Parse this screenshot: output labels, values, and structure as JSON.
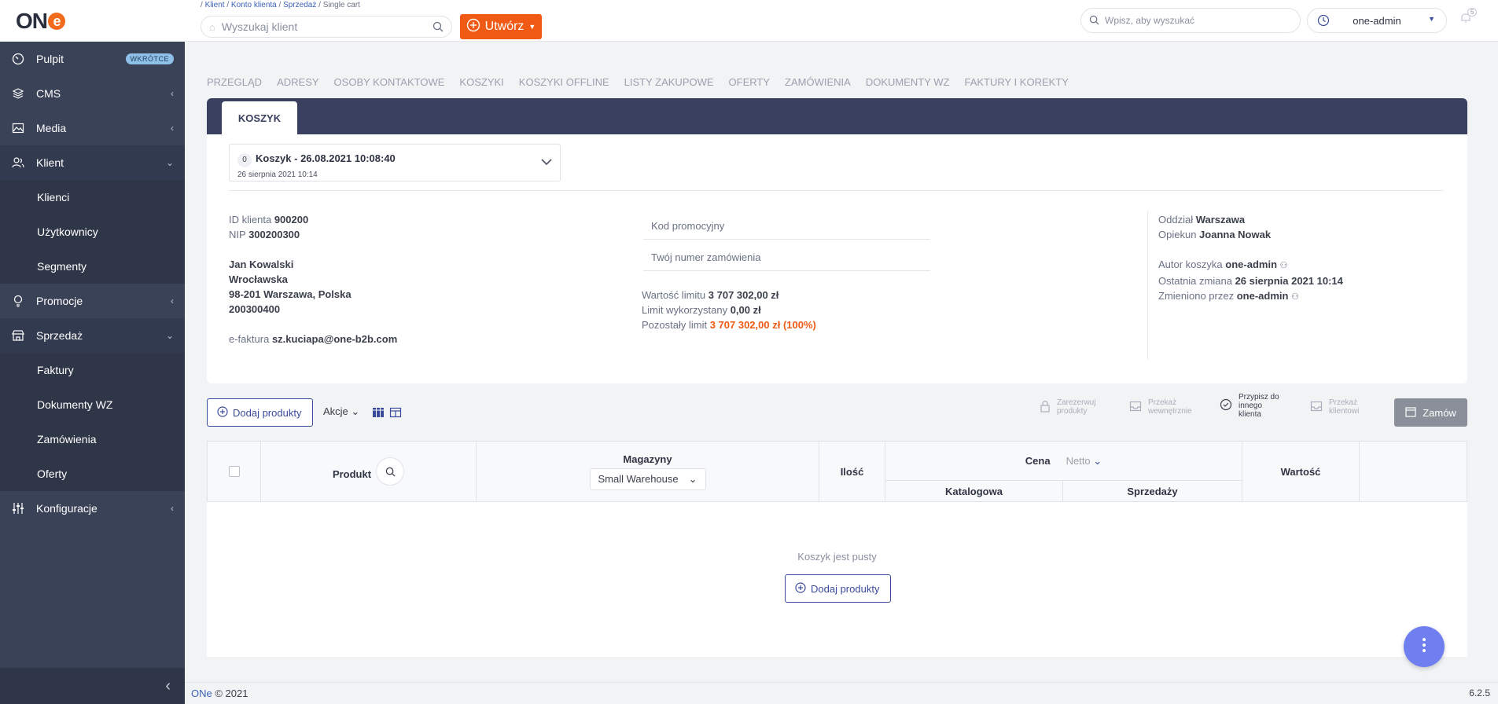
{
  "brand": {
    "name_prefix": "ON",
    "name_e": "e"
  },
  "sidebar": {
    "items": [
      {
        "label": "Pulpit",
        "icon": "dashboard-icon",
        "badge": "WKRÓTCE"
      },
      {
        "label": "CMS",
        "icon": "layers-icon"
      },
      {
        "label": "Media",
        "icon": "image-icon"
      },
      {
        "label": "Klient",
        "icon": "users-icon"
      },
      {
        "label": "Klienci"
      },
      {
        "label": "Użytkownicy"
      },
      {
        "label": "Segmenty"
      },
      {
        "label": "Promocje",
        "icon": "bulb-icon"
      },
      {
        "label": "Sprzedaż",
        "icon": "store-icon"
      },
      {
        "label": "Faktury"
      },
      {
        "label": "Dokumenty WZ"
      },
      {
        "label": "Zamówienia"
      },
      {
        "label": "Oferty"
      },
      {
        "label": "Konfiguracje",
        "icon": "sliders-icon"
      }
    ],
    "collapse": "‹"
  },
  "breadcrumb": [
    "Klient",
    "Konto klienta",
    "Sprzedaż",
    "Single cart"
  ],
  "topbar": {
    "client_search_placeholder": "Wyszukaj klient",
    "create_label": "Utwórz",
    "global_search_placeholder": "Wpisz, aby wyszukać",
    "user": "one-admin",
    "notif_count": "5"
  },
  "tabs": [
    "PRZEGLĄD",
    "ADRESY",
    "OSOBY KONTAKTOWE",
    "KOSZYKI",
    "KOSZYKI OFFLINE",
    "LISTY ZAKUPOWE",
    "OFERTY",
    "ZAMÓWIENIA",
    "DOKUMENTY WZ",
    "FAKTURY I KOREKTY"
  ],
  "card_tab": "KOSZYK",
  "cart": {
    "count": "0",
    "title": "Koszyk - 26.08.2021 10:08:40",
    "date": "26 sierpnia 2021 10:14"
  },
  "client": {
    "id_label": "ID klienta",
    "id": "900200",
    "nip_label": "NIP",
    "nip": "300200300",
    "name": "Jan Kowalski",
    "street": "Wrocławska",
    "city": "98-201 Warszawa, Polska",
    "phone": "200300400",
    "efaktura_label": "e-faktura",
    "email": "sz.kuciapa@one-b2b.com"
  },
  "fields": {
    "promo": "Kod promocyjny",
    "order_no": "Twój numer zamówienia"
  },
  "limits": {
    "value_label": "Wartość limitu",
    "value": "3 707 302,00 zł",
    "used_label": "Limit wykorzystany",
    "used": "0,00 zł",
    "left_label": "Pozostały limit",
    "left": "3 707 302,00 zł (100%)"
  },
  "meta": {
    "branch_label": "Oddział",
    "branch": "Warszawa",
    "keeper_label": "Opiekun",
    "keeper": "Joanna Nowak",
    "author_label": "Autor koszyka",
    "author": "one-admin",
    "changed_label": "Ostatnia zmiana",
    "changed": "26 sierpnia 2021 10:14",
    "changed_by_label": "Zmieniono przez",
    "changed_by": "one-admin"
  },
  "toolbar": {
    "add_products": "Dodaj produkty",
    "actions": "Akcje",
    "reserve": [
      "Zarezerwuj",
      "produkty"
    ],
    "transfer_internal": [
      "Przekaż",
      "wewnętrznie"
    ],
    "assign": [
      "Przypisz do",
      "innego",
      "klienta"
    ],
    "transfer_client": [
      "Przekaż",
      "klientowi"
    ],
    "order": "Zamów"
  },
  "table": {
    "product": "Produkt",
    "warehouses": "Magazyny",
    "warehouse_selected": "Small Warehouse",
    "qty": "Ilość",
    "price": "Cena",
    "price_mode": "Netto",
    "catalog": "Katalogowa",
    "sale": "Sprzedaży",
    "value": "Wartość",
    "empty": "Koszyk jest pusty",
    "add_products": "Dodaj produkty"
  },
  "footer": {
    "brand": "ONe",
    "copy": "© 2021",
    "version": "6.2.5"
  },
  "colors": {
    "accent": "#f05a14",
    "sidebar": "#3a4257",
    "header_band": "#3a4160",
    "primary": "#3a4a9c"
  }
}
